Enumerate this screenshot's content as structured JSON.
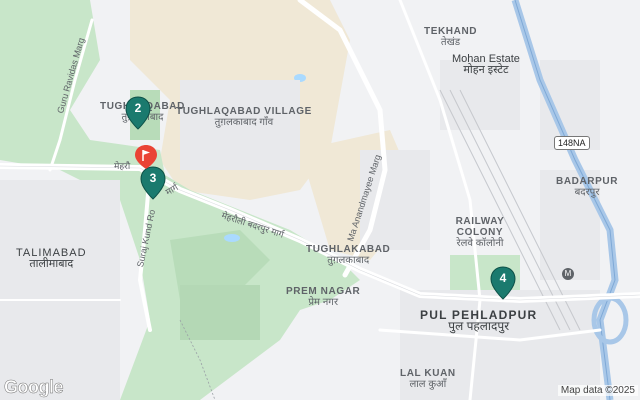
{
  "areas": [
    {
      "id": "tekhand",
      "en": "TEKHAND",
      "hi": "तेखंड"
    },
    {
      "id": "mohan_estate",
      "en": "Mohan Estate",
      "hi": "मोहन इस्टेट"
    },
    {
      "id": "tughlaqabad",
      "en": "TUGHLAQABAD",
      "hi": "तुग़लक़ाबाद"
    },
    {
      "id": "tughlaqabad_village",
      "en": "TUGHLAQABAD VILLAGE",
      "hi": "तुग़लकाबाद गाँव"
    },
    {
      "id": "badarpur",
      "en": "BADARPUR",
      "hi": "बदरपुर"
    },
    {
      "id": "railway_colony",
      "en": "RAILWAY COLONY",
      "hi": "रेलवे कॉलोनी"
    },
    {
      "id": "tughlakabad",
      "en": "TUGHLAKABAD",
      "hi": "तुग़लकाबाद"
    },
    {
      "id": "talimabad",
      "en": "TALIMABAD",
      "hi": "तालीमाबाद"
    },
    {
      "id": "prem_nagar",
      "en": "PREM NAGAR",
      "hi": "प्रेम नगर"
    },
    {
      "id": "pul_pehladpur",
      "en": "PUL PEHLADPUR",
      "hi": "पुल पहलादपुर"
    },
    {
      "id": "lal_kuan",
      "en": "LAL KUAN",
      "hi": "लाल कुआँ"
    }
  ],
  "roads": {
    "guru_ravidas": "Guru Ravidas Marg",
    "ma_anandmayee": "Ma Anandmayee Marg",
    "mehrauli_badarpur": "मेहरौली बदरपुर मार्ग",
    "mehrauli_short": "मेहरौ",
    "suraj_kund": "Suraj Kund Ro",
    "suraj_kund_hi": "मार्ग"
  },
  "highway_shield": "148NA",
  "markers": [
    {
      "id": "2",
      "label": "2",
      "color": "#1a7a6e"
    },
    {
      "id": "3",
      "label": "3",
      "color": "#1a7a6e"
    },
    {
      "id": "4",
      "label": "4",
      "color": "#1a7a6e"
    },
    {
      "id": "flag",
      "label": "",
      "color": "#ea4335"
    }
  ],
  "attribution": {
    "logo": "Google",
    "credit": "Map data ©2025"
  },
  "colors": {
    "park": "#c8e6c9",
    "desert": "#f0e8d6",
    "road": "#ffffff",
    "highway": "#a8c7e8",
    "water": "#aadaff",
    "marker": "#1a7a6e"
  }
}
